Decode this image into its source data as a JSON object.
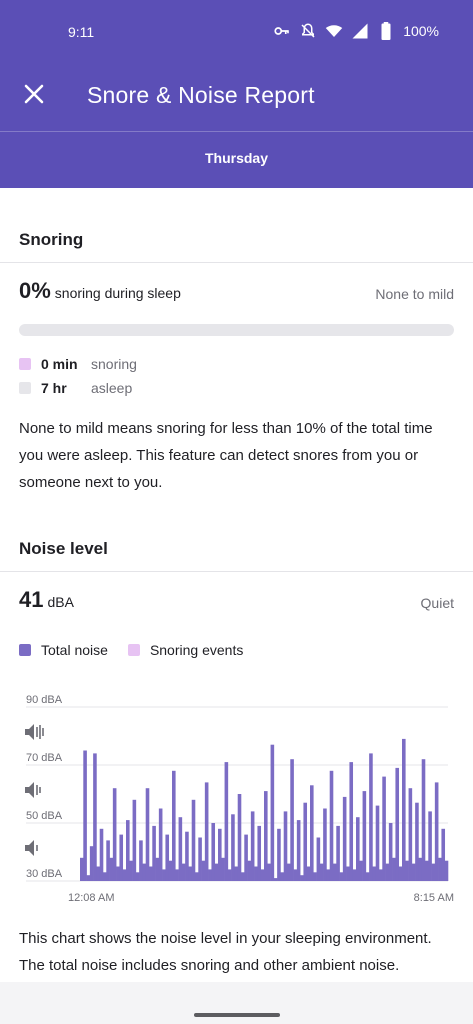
{
  "status": {
    "time": "9:11",
    "battery": "100%"
  },
  "appbar": {
    "title": "Snore & Noise Report",
    "close_icon": "close-icon"
  },
  "tab": {
    "day": "Thursday"
  },
  "snoring": {
    "title": "Snoring",
    "percent": "0%",
    "percent_label": "snoring during sleep",
    "rating": "None to mild",
    "progress_fraction": 0,
    "legend": [
      {
        "value": "0 min",
        "label": "snoring",
        "color": "#e7c3f3"
      },
      {
        "value": "7 hr",
        "label": "asleep",
        "color": "#e6e6ea"
      }
    ],
    "description": "None to mild means snoring for less than 10% of the total time you were asleep. This feature can detect snores from you or someone next to you."
  },
  "noise": {
    "title": "Noise level",
    "value": "41",
    "unit": "dBA",
    "rating": "Quiet",
    "legend": [
      {
        "label": "Total noise",
        "color": "#7b6cc4"
      },
      {
        "label": "Snoring events",
        "color": "#e7c3f3"
      }
    ],
    "description": "This chart shows the noise level in your sleeping environment. The total noise includes snoring and other ambient noise."
  },
  "chart_data": {
    "type": "area",
    "ylabels": [
      "90 dBA",
      "70 dBA",
      "50 dBA",
      "30 dBA"
    ],
    "ylim": [
      30,
      90
    ],
    "xlabels": [
      "12:08 AM",
      "8:15 AM"
    ],
    "series": [
      {
        "values": [
          38,
          75,
          32,
          42,
          74,
          35,
          48,
          33,
          44,
          38,
          62,
          35,
          46,
          34,
          51,
          37,
          58,
          33,
          44,
          36,
          62,
          35,
          49,
          38,
          55,
          34,
          46,
          37,
          68,
          34,
          52,
          36,
          47,
          35,
          58,
          33,
          45,
          37,
          64,
          34,
          50,
          36,
          48,
          38,
          71,
          34,
          53,
          35,
          60,
          33,
          46,
          37,
          54,
          35,
          49,
          34,
          61,
          36,
          77,
          31,
          48,
          33,
          54,
          36,
          72,
          34,
          51,
          32,
          57,
          35,
          63,
          33,
          45,
          36,
          55,
          34,
          68,
          36,
          49,
          33,
          59,
          35,
          71,
          34,
          52,
          37,
          61,
          33,
          74,
          35,
          56,
          34,
          66,
          36,
          50,
          38,
          69,
          35,
          79,
          37,
          62,
          36,
          57,
          38,
          72,
          37,
          54,
          36,
          64,
          38,
          48,
          37
        ]
      }
    ]
  }
}
